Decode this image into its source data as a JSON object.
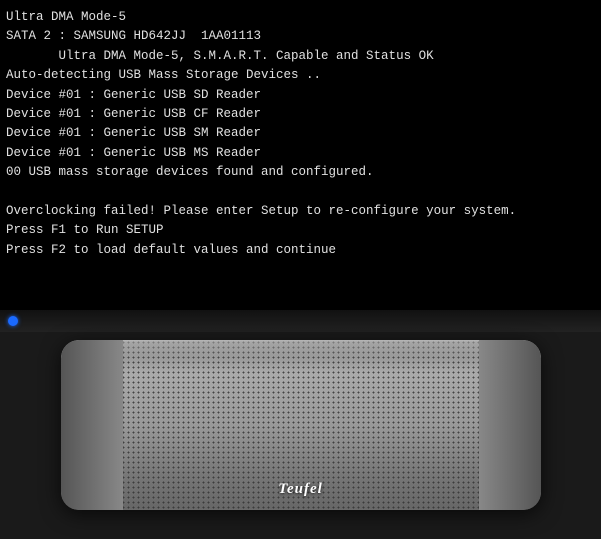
{
  "screen": {
    "lines": [
      "Ultra DMA Mode-5",
      "SATA 2 : SAMSUNG HD642JJ  1AA01113",
      "       Ultra DMA Mode-5, S.M.A.R.T. Capable and Status OK",
      "Auto-detecting USB Mass Storage Devices ..",
      "Device #01 : Generic USB SD Reader",
      "Device #01 : Generic USB CF Reader",
      "Device #01 : Generic USB SM Reader",
      "Device #01 : Generic USB MS Reader",
      "00 USB mass storage devices found and configured.",
      "",
      "Overclocking failed! Please enter Setup to re-configure your system.",
      "Press F1 to Run SETUP",
      "Press F2 to load default values and continue"
    ]
  },
  "speaker": {
    "brand": "Teufel"
  }
}
